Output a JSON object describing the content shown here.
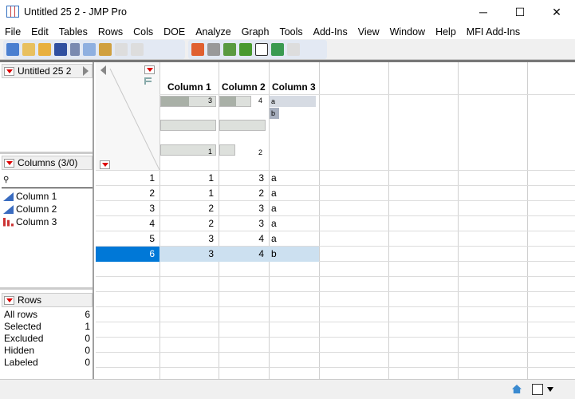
{
  "window": {
    "title": "Untitled 25 2 - JMP Pro",
    "minimize": "─",
    "maximize": "☐",
    "close": "✕"
  },
  "menu": [
    "File",
    "Edit",
    "Tables",
    "Rows",
    "Cols",
    "DOE",
    "Analyze",
    "Graph",
    "Tools",
    "Add-Ins",
    "View",
    "Window",
    "Help",
    "MFI Add-Ins"
  ],
  "table_panel": {
    "name": "Untitled 25 2"
  },
  "columns_panel": {
    "header": "Columns (3/0)",
    "items": [
      {
        "name": "Column 1",
        "type": "continuous"
      },
      {
        "name": "Column 2",
        "type": "continuous"
      },
      {
        "name": "Column 3",
        "type": "nominal"
      }
    ]
  },
  "rows_panel": {
    "header": "Rows",
    "stats": [
      {
        "label": "All rows",
        "value": "6"
      },
      {
        "label": "Selected",
        "value": "1"
      },
      {
        "label": "Excluded",
        "value": "0"
      },
      {
        "label": "Hidden",
        "value": "0"
      },
      {
        "label": "Labeled",
        "value": "0"
      }
    ]
  },
  "grid": {
    "columns": [
      "Column 1",
      "Column 2",
      "Column 3"
    ],
    "summary": {
      "c1_max": "3",
      "c1_min": "1",
      "c2_max": "4",
      "c2_min": "2",
      "c3_levels": [
        "a",
        "b"
      ]
    },
    "rows": [
      [
        "1",
        "1",
        "3",
        "a"
      ],
      [
        "2",
        "1",
        "2",
        "a"
      ],
      [
        "3",
        "2",
        "3",
        "a"
      ],
      [
        "4",
        "2",
        "3",
        "a"
      ],
      [
        "5",
        "3",
        "4",
        "a"
      ],
      [
        "6",
        "3",
        "4",
        "b"
      ]
    ],
    "selected_row": 6
  },
  "colors": {
    "selection": "#0078d7",
    "selected_cell": "#cce0f0",
    "red_triangle": "#dd0000"
  }
}
